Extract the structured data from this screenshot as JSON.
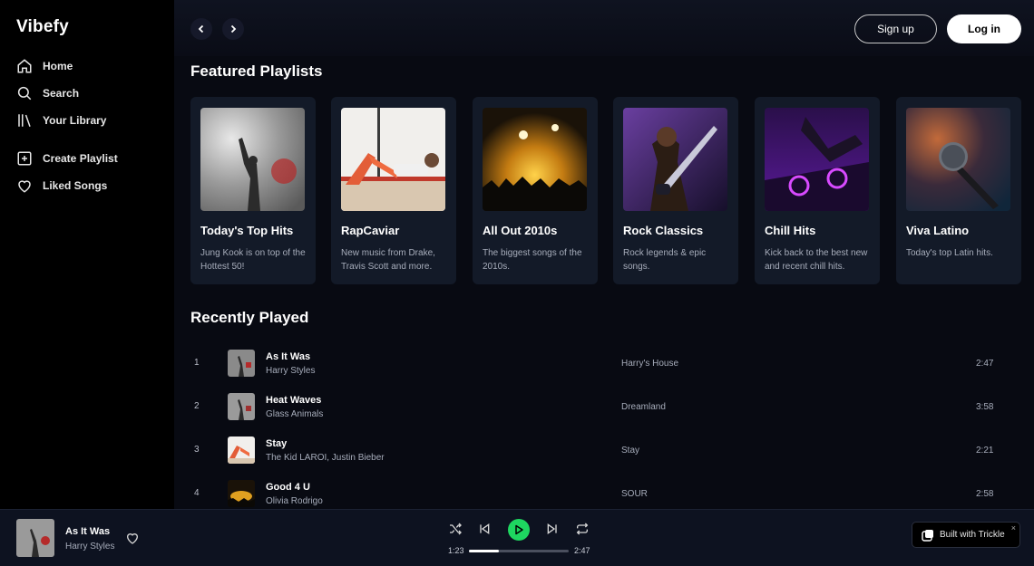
{
  "app": {
    "name": "Vibefy"
  },
  "sidebar": {
    "items": [
      {
        "label": "Home",
        "icon": "home-icon"
      },
      {
        "label": "Search",
        "icon": "search-icon"
      },
      {
        "label": "Your Library",
        "icon": "library-icon"
      },
      {
        "label": "Create Playlist",
        "icon": "plus-square-icon"
      },
      {
        "label": "Liked Songs",
        "icon": "heart-icon"
      }
    ]
  },
  "header": {
    "back_icon": "chevron-left-icon",
    "forward_icon": "chevron-right-icon",
    "signup_label": "Sign up",
    "login_label": "Log in"
  },
  "featured": {
    "title": "Featured Playlists",
    "playlists": [
      {
        "title": "Today's Top Hits",
        "description": "Jung Kook is on top of the Hottest 50!"
      },
      {
        "title": "RapCaviar",
        "description": "New music from Drake, Travis Scott and more."
      },
      {
        "title": "All Out 2010s",
        "description": "The biggest songs of the 2010s."
      },
      {
        "title": "Rock Classics",
        "description": "Rock legends & epic songs."
      },
      {
        "title": "Chill Hits",
        "description": "Kick back to the best new and recent chill hits."
      },
      {
        "title": "Viva Latino",
        "description": "Today's top Latin hits."
      }
    ]
  },
  "recent": {
    "title": "Recently Played",
    "tracks": [
      {
        "num": "1",
        "title": "As It Was",
        "artist": "Harry Styles",
        "album": "Harry's House",
        "duration": "2:47"
      },
      {
        "num": "2",
        "title": "Heat Waves",
        "artist": "Glass Animals",
        "album": "Dreamland",
        "duration": "3:58"
      },
      {
        "num": "3",
        "title": "Stay",
        "artist": "The Kid LAROI, Justin Bieber",
        "album": "Stay",
        "duration": "2:21"
      },
      {
        "num": "4",
        "title": "Good 4 U",
        "artist": "Olivia Rodrigo",
        "album": "SOUR",
        "duration": "2:58"
      }
    ]
  },
  "player": {
    "now_playing_title": "As It Was",
    "now_playing_artist": "Harry Styles",
    "current_time": "1:23",
    "total_time": "2:47",
    "progress": 0.3,
    "controls": [
      "shuffle-icon",
      "previous-icon",
      "play-icon",
      "next-icon",
      "repeat-icon"
    ],
    "accent_color": "#1ed760"
  },
  "badge": {
    "label": "Built with Trickle",
    "close": "×"
  }
}
